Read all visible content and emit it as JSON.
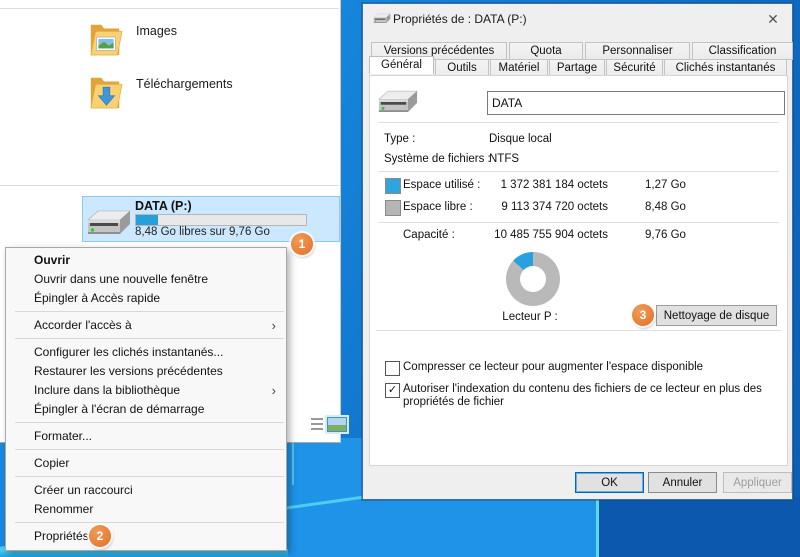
{
  "explorer": {
    "folders": [
      {
        "label": "Images"
      },
      {
        "label": "Téléchargements"
      }
    ],
    "drive": {
      "name": "DATA (P:)",
      "free_text": "8,48 Go libres sur 9,76 Go",
      "used_percent": 13
    }
  },
  "context_menu": {
    "items": [
      {
        "label": "Ouvrir",
        "bold": true
      },
      {
        "label": "Ouvrir dans une nouvelle fenêtre"
      },
      {
        "label": "Épingler à Accès rapide"
      },
      {
        "separator": true
      },
      {
        "label": "Accorder l'accès à",
        "submenu": true
      },
      {
        "separator": true
      },
      {
        "label": "Configurer les clichés instantanés..."
      },
      {
        "label": "Restaurer les versions précédentes"
      },
      {
        "label": "Inclure dans la bibliothèque",
        "submenu": true
      },
      {
        "label": "Épingler à l'écran de démarrage"
      },
      {
        "separator": true
      },
      {
        "label": "Formater..."
      },
      {
        "separator": true
      },
      {
        "label": "Copier"
      },
      {
        "separator": true
      },
      {
        "label": "Créer un raccourci"
      },
      {
        "label": "Renommer"
      },
      {
        "separator": true
      },
      {
        "label": "Propriétés"
      }
    ]
  },
  "annotations": {
    "step1": "1",
    "step2": "2",
    "step3": "3"
  },
  "dialog": {
    "title": "Propriétés de : DATA (P:)",
    "tabs_row1": [
      "Versions précédentes",
      "Quota",
      "Personnaliser",
      "Classification"
    ],
    "tabs_row2": [
      "Général",
      "Outils",
      "Matériel",
      "Partage",
      "Sécurité",
      "Clichés instantanés"
    ],
    "active_tab": "Général",
    "general": {
      "drive_name": "DATA",
      "type_label": "Type :",
      "type_value": "Disque local",
      "fs_label": "Système de fichiers :",
      "fs_value": "NTFS",
      "used_label": "Espace utilisé :",
      "used_bytes": "1 372 381 184 octets",
      "used_size": "1,27 Go",
      "free_label": "Espace libre :",
      "free_bytes": "9 113 374 720 octets",
      "free_size": "8,48 Go",
      "capacity_label": "Capacité :",
      "capacity_bytes": "10 485 755 904 octets",
      "capacity_size": "9,76 Go",
      "drive_letter_label": "Lecteur P :",
      "cleanup_button": "Nettoyage de disque",
      "compress_checkbox": "Compresser ce lecteur pour augmenter l'espace disponible",
      "index_checkbox": "Autoriser l'indexation du contenu des fichiers de ce lecteur en plus des propriétés de fichier",
      "usage_chart": {
        "type": "pie",
        "labels": [
          "Espace utilisé",
          "Espace libre"
        ],
        "values_go": [
          1.27,
          8.48
        ],
        "used_color": "#2aa1de",
        "free_color": "#b9b9b9"
      }
    },
    "buttons": {
      "ok": "OK",
      "cancel": "Annuler",
      "apply": "Appliquer"
    }
  },
  "icons": {
    "close": "✕",
    "submenu_arrow": "›",
    "check": "✓"
  },
  "colors": {
    "accent_blue": "#26a0da",
    "selection_blue": "#cce8ff",
    "badge_orange": "#e8813b"
  }
}
